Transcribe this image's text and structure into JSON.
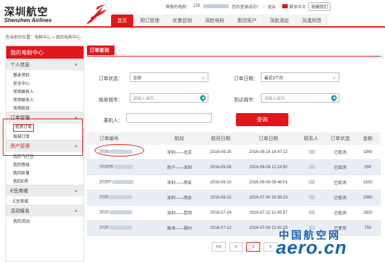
{
  "brand": {
    "cn": "深圳航空",
    "en": "Shenzhen Airlines"
  },
  "topbar": {
    "greeting": "尊敬的电粉：",
    "member_no": "135",
    "welcome": "您的登录成功！",
    "exit": "退出",
    "lang": "繁体中文",
    "collect": "收藏我们"
  },
  "nav": [
    "首页",
    "预订管理",
    "优惠促销",
    "深航电粉",
    "集团客户",
    "深航酒店",
    "凤凰知音"
  ],
  "breadcrumb": "您当前的位置：电粉中心 > 我的电粉中心",
  "sidebar": {
    "title": "我的电粉中心",
    "sections": [
      {
        "label": "个人信息",
        "items": [
          "基本资料",
          "安全中心",
          "常用乘机人",
          "常用联系人",
          "常用航线"
        ]
      },
      {
        "label": "订单管理",
        "items": [
          "机票订单",
          "局城订单"
        ]
      },
      {
        "label": "资产管理",
        "items": [
          "我的飞行豆",
          "我的等级",
          "我的卧量",
          "我的E券"
        ]
      },
      {
        "label": "E豆商城",
        "items": [
          "E豆商城"
        ]
      },
      {
        "label": "活动报名",
        "items": [
          "我的活动"
        ]
      }
    ]
  },
  "panel": {
    "tab": "订单查询"
  },
  "form": {
    "status_label": "订单状态：",
    "status_value": "全部",
    "date_label": "订单日期：",
    "date_value": "最近3个月",
    "from_label": "始发城市：",
    "from_placeholder": "请输入城市",
    "to_label": "到达城市：",
    "to_placeholder": "请输入城市",
    "passenger_label": "乘机人：",
    "search": "查询"
  },
  "table": {
    "headers": [
      "订单编号",
      "航段",
      "航班日期",
      "订单日期",
      "联系人",
      "订单状态",
      "金额"
    ],
    "rows": [
      {
        "order": "2016",
        "route": "深圳——北京",
        "flight_date": "2016-09-20",
        "order_date": "2016-09-18 16:47:12",
        "status": "已取消",
        "amount": "1940"
      },
      {
        "order": "201609",
        "route": "南宁——深圳",
        "flight_date": "2016-09-09",
        "order_date": "2016-09-09 11:24:50",
        "status": "已取消",
        "amount": "290"
      },
      {
        "order": "20160",
        "route": "深圳——西安",
        "flight_date": "2016-09-10",
        "order_date": "2016-09-09 09:46:01",
        "status": "已取消",
        "amount": "1530"
      },
      {
        "order": "2016",
        "route": "深圳——西安",
        "flight_date": "2016-08-22",
        "order_date": "2016-07-30 16:36:23",
        "status": "已取消",
        "amount": "2080"
      },
      {
        "order": "2016",
        "route": "深圳——昆明",
        "flight_date": "2016-07-24",
        "order_date": "2016-07-22 11:45:57",
        "status": "已取消",
        "amount": "1830"
      },
      {
        "order": "2016",
        "route": "珠海——福州",
        "flight_date": "2016-07-12",
        "order_date": "2016-07-08 12:42:28",
        "status": "已使用",
        "amount": "750"
      }
    ]
  },
  "pager": {
    "first": "<<",
    "prev": "<",
    "current": "1",
    "next": ">"
  },
  "watermark": {
    "cn": "中国航空网",
    "en": "aero.cn"
  }
}
